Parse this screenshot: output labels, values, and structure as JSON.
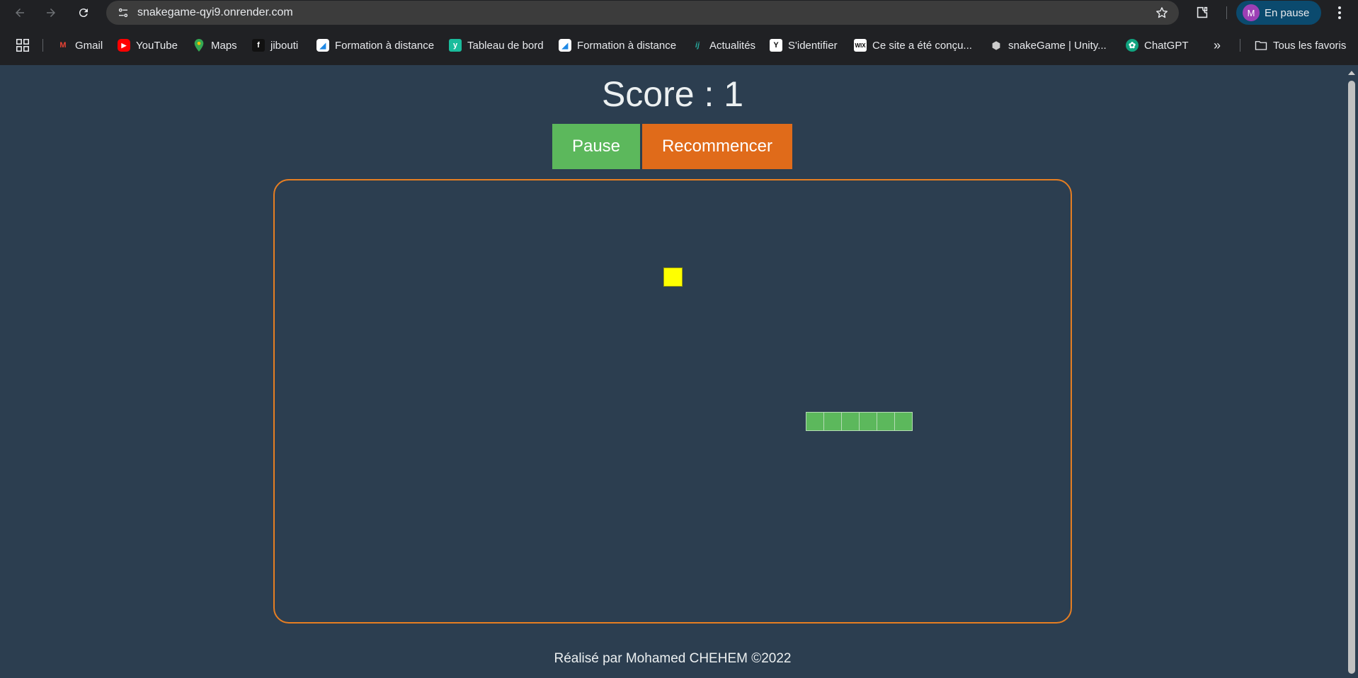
{
  "browser": {
    "url": "snakegame-qyi9.onrender.com",
    "profile_initial": "M",
    "profile_status": "En pause",
    "bookmarks": [
      {
        "label": "Gmail",
        "icon": "gmail-icon",
        "color": "#ea4335"
      },
      {
        "label": "YouTube",
        "icon": "youtube-icon",
        "color": "#ff0000"
      },
      {
        "label": "Maps",
        "icon": "maps-icon",
        "color": "#34a853"
      },
      {
        "label": "jibouti",
        "icon": "jibouti-icon",
        "color": "#111111"
      },
      {
        "label": "Formation à distance",
        "icon": "formation-icon",
        "color": "#1e88e5"
      },
      {
        "label": "Tableau de bord",
        "icon": "tableau-icon",
        "color": "#1abc9c"
      },
      {
        "label": "Formation à distance",
        "icon": "formation-icon",
        "color": "#1e88e5"
      },
      {
        "label": "Actualités",
        "icon": "actualites-icon",
        "color": "#26a69a"
      },
      {
        "label": "S'identifier",
        "icon": "identifier-icon",
        "color": "#ffffff"
      },
      {
        "label": "Ce site a été conçu...",
        "icon": "wix-icon",
        "color": "#ffffff"
      },
      {
        "label": "snakeGame | Unity...",
        "icon": "unity-icon",
        "color": "#cccccc"
      },
      {
        "label": "ChatGPT",
        "icon": "chatgpt-icon",
        "color": "#10a37f"
      }
    ],
    "more_label": "»",
    "all_bookmarks_label": "Tous les favoris"
  },
  "game": {
    "score_label": "Score : 1",
    "pause_label": "Pause",
    "restart_label": "Recommencer",
    "colors": {
      "background": "#2c3e50",
      "pause_button": "#5cb85c",
      "restart_button": "#e06b1a",
      "board_border": "#e67e22",
      "food": "#ffff00",
      "snake": "#5cb85c"
    }
  },
  "footer": {
    "text": "Réalisé par Mohamed CHEHEM ©2022"
  }
}
